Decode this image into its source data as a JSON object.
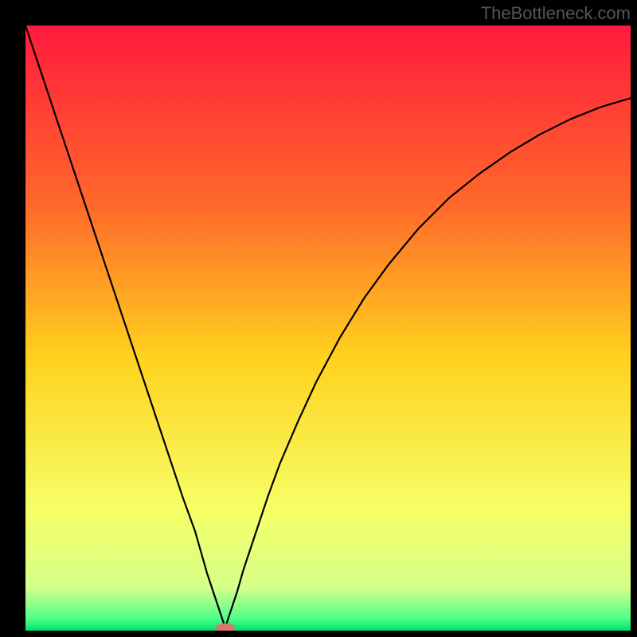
{
  "watermark": "TheBottleneck.com",
  "chart_data": {
    "type": "line",
    "title": "",
    "xlabel": "",
    "ylabel": "",
    "xlim": [
      0,
      100
    ],
    "ylim": [
      0,
      100
    ],
    "background_gradient": {
      "stops": [
        {
          "offset": 0.0,
          "color": "#ff1a3d"
        },
        {
          "offset": 0.3,
          "color": "#ff6a2a"
        },
        {
          "offset": 0.55,
          "color": "#ffd21e"
        },
        {
          "offset": 0.8,
          "color": "#f6ff66"
        },
        {
          "offset": 0.93,
          "color": "#d4ff8a"
        },
        {
          "offset": 0.98,
          "color": "#4fff8a"
        },
        {
          "offset": 1.0,
          "color": "#00e06a"
        }
      ]
    },
    "marker": {
      "x": 33,
      "y": 0,
      "color": "#d9776d",
      "rx": 1.6,
      "ry": 0.8
    },
    "curve": {
      "x": [
        0,
        2,
        4,
        6,
        8,
        10,
        12,
        14,
        16,
        18,
        20,
        22,
        24,
        26,
        28,
        30,
        31,
        32,
        33,
        34,
        35,
        36,
        38,
        40,
        42,
        45,
        48,
        52,
        56,
        60,
        65,
        70,
        75,
        80,
        85,
        90,
        95,
        100
      ],
      "y": [
        100,
        94,
        88,
        82,
        76,
        70,
        64,
        58,
        52,
        46,
        40,
        34,
        28,
        22,
        16.5,
        9.5,
        6.5,
        3.5,
        0.5,
        3.5,
        6.5,
        10,
        16,
        22,
        27.5,
        34.5,
        41,
        48.5,
        55,
        60.5,
        66.5,
        71.5,
        75.5,
        79,
        82,
        84.5,
        86.5,
        88
      ]
    }
  }
}
